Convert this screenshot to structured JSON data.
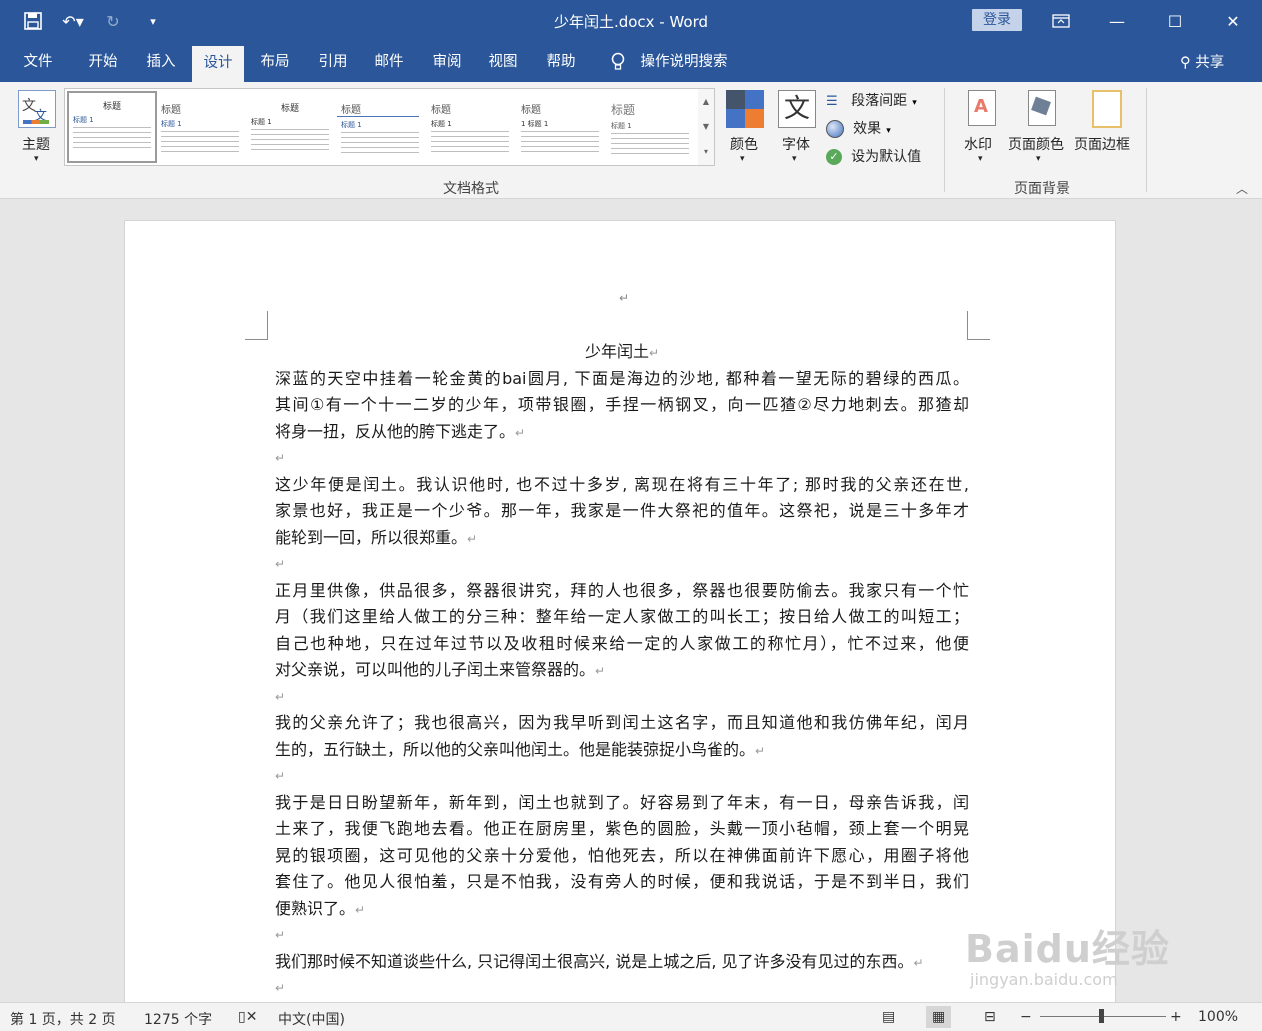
{
  "window": {
    "title": "少年闰土.docx  -  Word",
    "login_label": "登录"
  },
  "tabs": [
    {
      "label": "文件"
    },
    {
      "label": "开始"
    },
    {
      "label": "插入"
    },
    {
      "label": "设计"
    },
    {
      "label": "布局"
    },
    {
      "label": "引用"
    },
    {
      "label": "邮件"
    },
    {
      "label": "审阅"
    },
    {
      "label": "视图"
    },
    {
      "label": "帮助"
    }
  ],
  "tell_me": "操作说明搜索",
  "share_label": "共享",
  "ribbon": {
    "theme_label": "主题",
    "gallery": [
      {
        "title": "标题",
        "sub": "标题 1"
      },
      {
        "title": "标题",
        "sub": "标题 1"
      },
      {
        "title": "标题",
        "sub": "标题 1"
      },
      {
        "title": "标题",
        "sub": "标题 1"
      },
      {
        "title": "标题",
        "sub": "标题 1"
      },
      {
        "title": "标题",
        "sub": "1  标题 1"
      },
      {
        "title": "标题",
        "sub": "标题 1"
      }
    ],
    "colors_label": "颜色",
    "fonts_label": "字体",
    "paragraph_spacing_label": "段落间距",
    "effects_label": "效果",
    "set_default_label": "设为默认值",
    "group_doc_format": "文档格式",
    "watermark_label": "水印",
    "page_color_label": "页面颜色",
    "page_border_label": "页面边框",
    "group_page_bg": "页面背景"
  },
  "document": {
    "title": "少年闰土",
    "paragraphs": [
      [
        "深蓝的天空中挂着一轮金黄的bai圆月, 下面是海边的沙地, 都种着一望无际的碧绿的西瓜。",
        "其间①有一个十一二岁的少年，项带银圈，手捏一柄钢叉，向一匹猹②尽力地刺去。那猹却",
        "将身一扭，反从他的胯下逃走了。"
      ],
      [
        "这少年便是闰土。我认识他时, 也不过十多岁, 离现在将有三十年了; 那时我的父亲还在世,",
        "家景也好，我正是一个少爷。那一年，我家是一件大祭祀的值年。这祭祀，说是三十多年才",
        "能轮到一回，所以很郑重。"
      ],
      [
        "正月里供像，供品很多，祭器很讲究，拜的人也很多，祭器也很要防偷去。我家只有一个忙",
        "月（我们这里给人做工的分三种：整年给一定人家做工的叫长工；按日给人做工的叫短工；",
        "自己也种地，只在过年过节以及收租时候来给一定的人家做工的称忙月），忙不过来，他便",
        "对父亲说，可以叫他的儿子闰土来管祭器的。"
      ],
      [
        "我的父亲允许了；我也很高兴，因为我早听到闰土这名字，而且知道他和我仿佛年纪，闰月",
        "生的，五行缺土，所以他的父亲叫他闰土。他是能装弶捉小鸟雀的。"
      ],
      [
        "我于是日日盼望新年，新年到，闰土也就到了。好容易到了年末，有一日，母亲告诉我，闰",
        "土来了，我便飞跑地去看。他正在厨房里，紫色的圆脸，头戴一顶小毡帽，颈上套一个明晃",
        "晃的银项圈，这可见他的父亲十分爱他，怕他死去，所以在神佛面前许下愿心，用圈子将他",
        "套住了。他见人很怕羞，只是不怕我，没有旁人的时候，便和我说话，于是不到半日，我们",
        "便熟识了。"
      ],
      [
        "我们那时候不知道谈些什么, 只记得闰土很高兴, 说是上城之后, 见了许多没有见过的东西。"
      ]
    ]
  },
  "status": {
    "page": "第 1 页，共 2 页",
    "words": "1275 个字",
    "language": "中文(中国)",
    "zoom": "100%"
  },
  "watermark_text": "Baidu经验",
  "watermark_sub": "jingyan.baidu.com"
}
